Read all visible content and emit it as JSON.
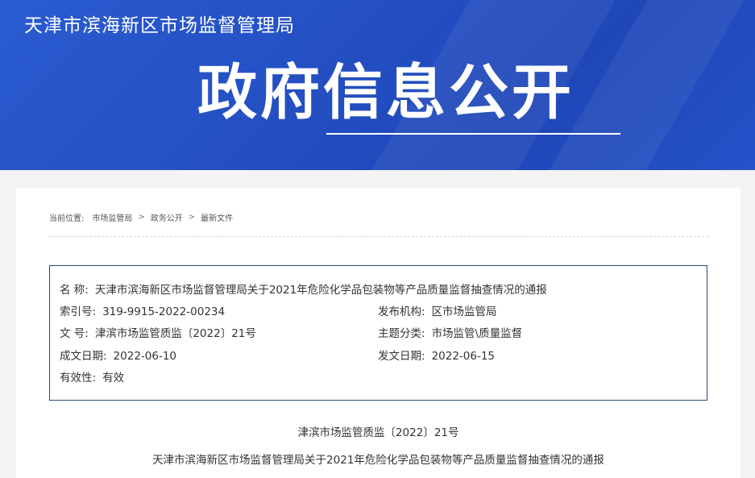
{
  "header": {
    "agency": "天津市滨海新区市场监督管理局",
    "title": "政府信息公开"
  },
  "breadcrumb": {
    "label": "当前位置:",
    "items": [
      "市场监管局",
      "政务公开",
      "最新文件"
    ],
    "sep": ">"
  },
  "meta": {
    "name_label": "名  称:",
    "name_value": "天津市滨海新区市场监督管理局关于2021年危险化学品包装物等产品质量监督抽查情况的通报",
    "index_label": "索引号:",
    "index_value": "319-9915-2022-00234",
    "publisher_label": "发布机构:",
    "publisher_value": "区市场监管局",
    "docno_label": "文  号:",
    "docno_value": "津滨市场监管质监〔2022〕21号",
    "topic_label": "主题分类:",
    "topic_value": "市场监管\\质量监督",
    "created_label": "成文日期:",
    "created_value": "2022-06-10",
    "issued_label": "发文日期:",
    "issued_value": "2022-06-15",
    "validity_label": "有效性:",
    "validity_value": "有效"
  },
  "document": {
    "number": "津滨市场监管质监〔2022〕21号",
    "title": "天津市滨海新区市场监督管理局关于2021年危险化学品包装物等产品质量监督抽查情况的通报"
  }
}
